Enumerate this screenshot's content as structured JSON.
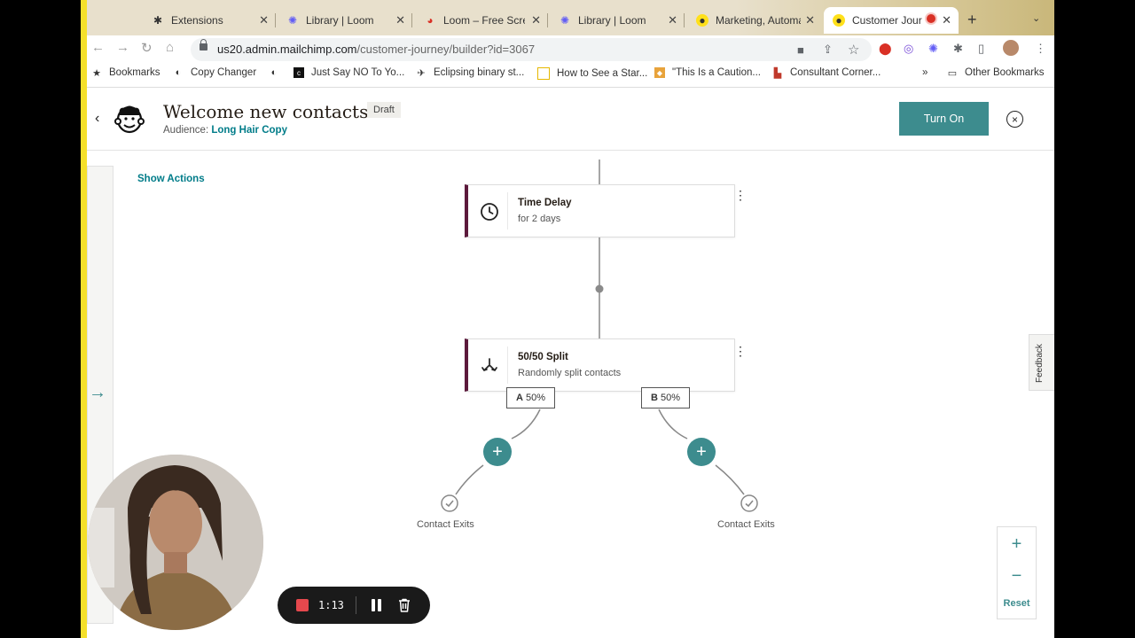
{
  "browser": {
    "tabs": [
      {
        "title": "Extensions",
        "favicon": "puzzle-icon"
      },
      {
        "title": "Library | Loom",
        "favicon": "loom-icon"
      },
      {
        "title": "Loom – Free Scree",
        "favicon": "chrome-icon"
      },
      {
        "title": "Library | Loom",
        "favicon": "loom-icon"
      },
      {
        "title": "Marketing, Automa",
        "favicon": "mailchimp-icon"
      },
      {
        "title": "Customer Jour",
        "favicon": "mailchimp-icon",
        "active": true
      }
    ],
    "url_host": "us20.admin.mailchimp.com",
    "url_path": "/customer-journey/builder?id=3067",
    "bookmarks": [
      "Bookmarks",
      "Copy Changer",
      "",
      "Just Say NO To Yo...",
      "Eclipsing binary st...",
      "How to See a Star...",
      "\"This Is a Caution...",
      "Consultant Corner..."
    ],
    "bookmarks_overflow": "»",
    "other_bookmarks": "Other Bookmarks"
  },
  "header": {
    "back": "‹",
    "title": "Welcome new contacts",
    "status_badge": "Draft",
    "audience_label": "Audience:",
    "audience_name": "Long Hair Copy",
    "turn_on_label": "Turn On",
    "close": "×"
  },
  "canvas": {
    "show_actions_label": "Show Actions",
    "side_arrow": "→",
    "feedback_label": "Feedback",
    "time_delay": {
      "title": "Time Delay",
      "subtitle": "for 2 days"
    },
    "split": {
      "title": "50/50 Split",
      "subtitle": "Randomly split contacts"
    },
    "branch_a": {
      "letter": "A",
      "percent": "50%"
    },
    "branch_b": {
      "letter": "B",
      "percent": "50%"
    },
    "exit_label_a": "Contact Exits",
    "exit_label_b": "Contact Exits",
    "zoom_in": "+",
    "zoom_out": "−",
    "reset_label": "Reset"
  },
  "recorder": {
    "time": "1:13"
  },
  "colors": {
    "accent": "#3d8c8e",
    "link": "#007c89",
    "card_accent": "#5c1a3c",
    "record": "#e5484d",
    "recorder_edge": "#f5e02a"
  }
}
